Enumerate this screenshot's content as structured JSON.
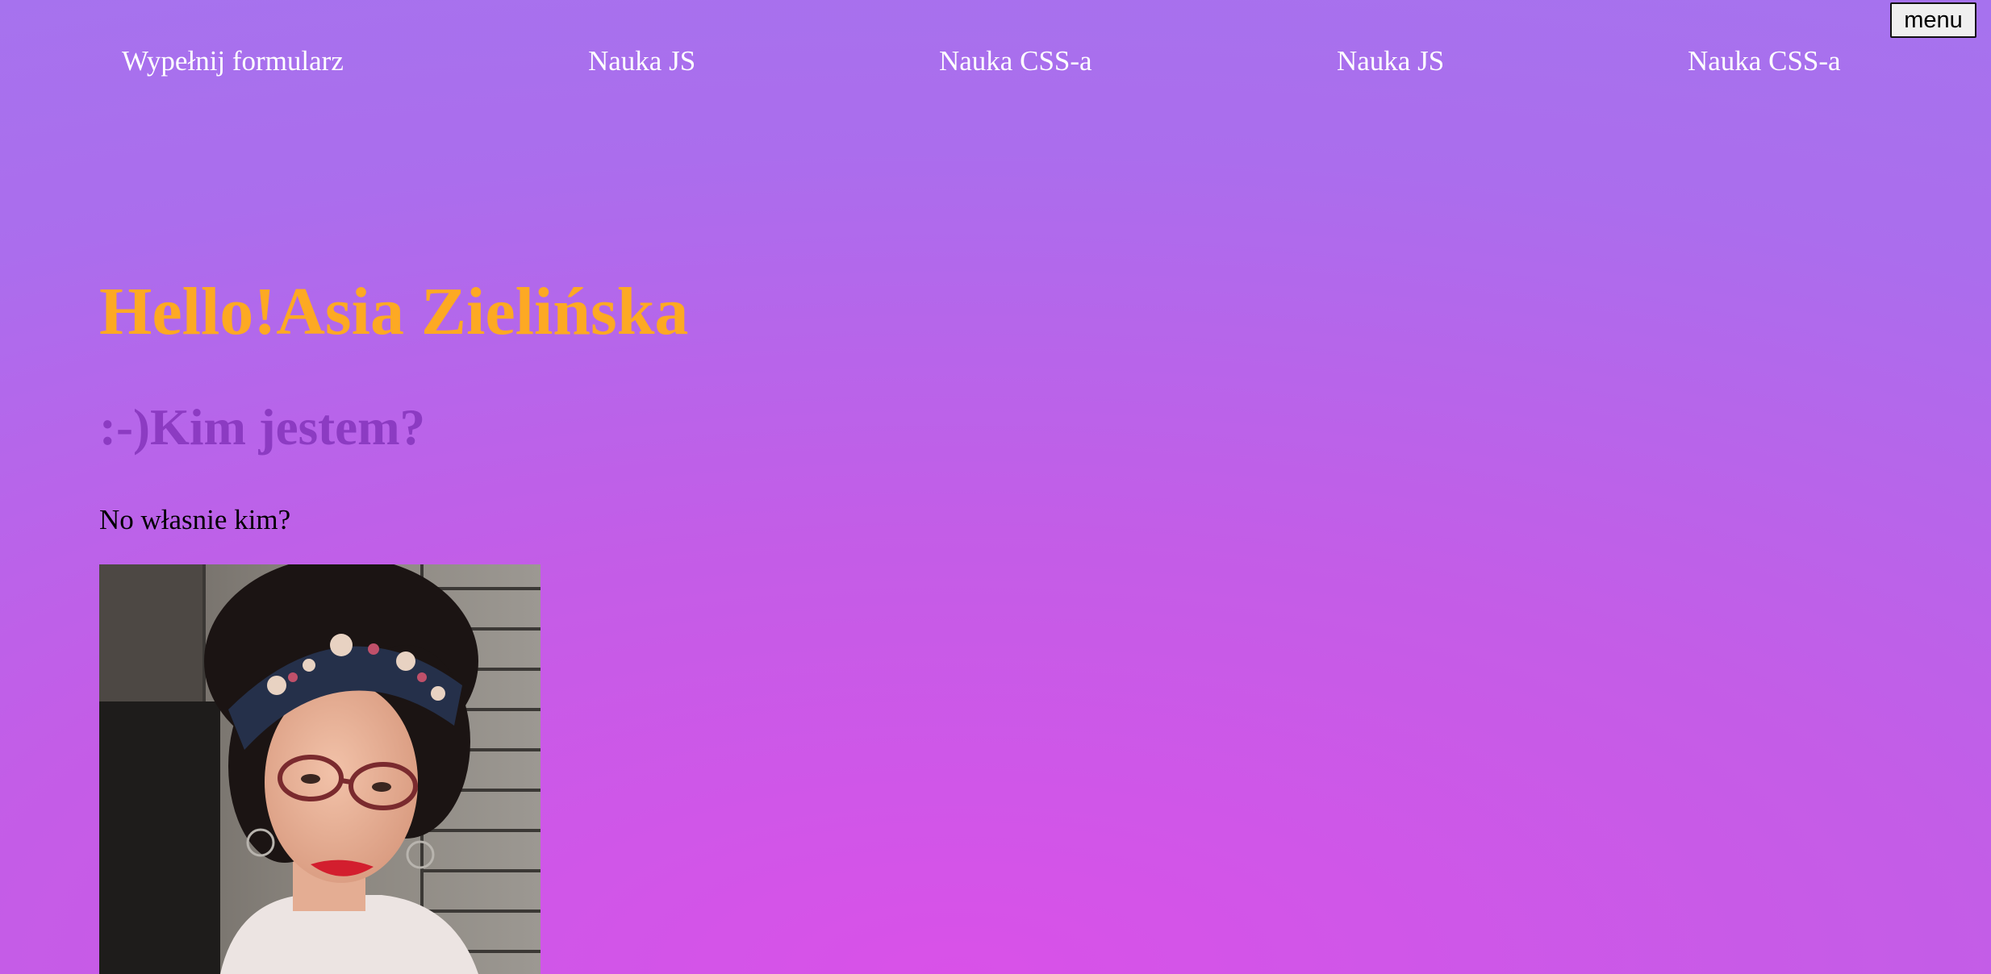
{
  "toolbar": {
    "menu_label": "menu"
  },
  "nav": {
    "items": [
      {
        "label": "Wypełnij formularz"
      },
      {
        "label": "Nauka JS"
      },
      {
        "label": "Nauka CSS-a"
      },
      {
        "label": "Nauka JS"
      },
      {
        "label": "Nauka CSS-a"
      }
    ]
  },
  "hero": {
    "title": "Hello!Asia Zielińska"
  },
  "about": {
    "heading": ":-)Kim jestem?",
    "text": "No własnie kim?"
  },
  "colors": {
    "gradient_top": "#a277ee",
    "gradient_bottom": "#d951e8",
    "title": "#fda923",
    "subtitle": "#8c3bc2",
    "nav_text": "#ffffff",
    "body_text": "#000000"
  }
}
